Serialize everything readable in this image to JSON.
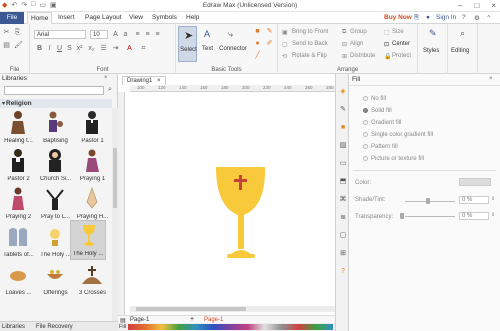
{
  "window": {
    "title": "Edraw Max (Unlicensed Version)"
  },
  "tabs": {
    "file": "File",
    "home": "Home",
    "insert": "Insert",
    "page_layout": "Page Layout",
    "view": "View",
    "symbols": "Symbols",
    "help": "Help",
    "buy_now": "Buy Now",
    "sign_in": "Sign In"
  },
  "ribbon": {
    "font_name": "Arial",
    "font_size": "10",
    "select": "Select",
    "text": "Text",
    "connector": "Connector",
    "bring_to_front": "Bring to Front",
    "send_to_back": "Send to Back",
    "rotate_flip": "Rotate & Flip",
    "group": "Group",
    "align": "Align",
    "distribute": "Distribute",
    "size": "Size",
    "center": "Center",
    "protect": "Protect",
    "styles": "Styles",
    "editing": "Editing",
    "groups": {
      "file": "File",
      "font": "Font",
      "basic_tools": "Basic Tools",
      "arrange": "Arrange"
    }
  },
  "libraries": {
    "title": "Libraries",
    "category": "Religion",
    "footer_left": "Libraries",
    "footer_right": "File Recovery",
    "items": [
      {
        "label": "Healing t..."
      },
      {
        "label": "Baptising"
      },
      {
        "label": "Pastor 1"
      },
      {
        "label": "Pastor 2"
      },
      {
        "label": "Church Si..."
      },
      {
        "label": "Praying 1"
      },
      {
        "label": "Praying 2"
      },
      {
        "label": "Pray to L..."
      },
      {
        "label": "Praying H..."
      },
      {
        "label": "Tablets of..."
      },
      {
        "label": "The Holy ..."
      },
      {
        "label": "The Holy ..."
      },
      {
        "label": "Loaves ..."
      },
      {
        "label": "Offerings"
      },
      {
        "label": "3 Crosses"
      }
    ]
  },
  "canvas": {
    "doc_tab": "Drawing1",
    "ruler_ticks": [
      "100",
      "120",
      "140",
      "160",
      "180",
      "200",
      "220",
      "240",
      "260",
      "280"
    ],
    "page_tab1": "Page-1",
    "page_tab2": "Page-1",
    "fill_label": "Fill"
  },
  "fill_panel": {
    "title": "Fill",
    "options": [
      "No fill",
      "Solid fill",
      "Gradient fill",
      "Single color gradient fill",
      "Pattern fill",
      "Picture or texture fill"
    ],
    "color_label": "Color:",
    "shade_label": "Shade/Tint:",
    "shade_value": "0 %",
    "transparency_label": "Transparency:",
    "transparency_value": "0 %"
  },
  "colors": {
    "chalice": "#f8c93a",
    "cross": "#c9423a",
    "file_tab": "#3b5893",
    "accent": "#d44a1c"
  }
}
